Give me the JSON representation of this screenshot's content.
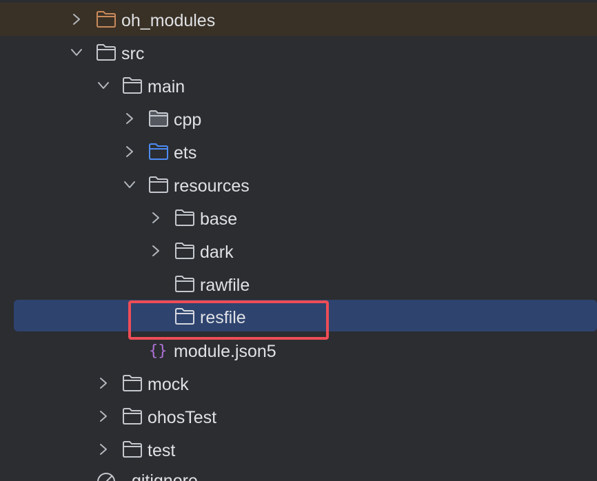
{
  "tree": {
    "items": [
      {
        "label": "oh_modules",
        "icon": "folder-icon",
        "chevron": "right",
        "color": "#c98a5b"
      },
      {
        "label": "src",
        "icon": "folder-icon",
        "chevron": "down"
      },
      {
        "label": "main",
        "icon": "folder-icon",
        "chevron": "down"
      },
      {
        "label": "cpp",
        "icon": "folder-icon",
        "chevron": "right"
      },
      {
        "label": "ets",
        "icon": "folder-icon",
        "chevron": "right",
        "color": "#4d8cf5"
      },
      {
        "label": "resources",
        "icon": "folder-icon",
        "chevron": "down"
      },
      {
        "label": "base",
        "icon": "folder-icon",
        "chevron": "right"
      },
      {
        "label": "dark",
        "icon": "folder-icon",
        "chevron": "right"
      },
      {
        "label": "rawfile",
        "icon": "folder-icon",
        "chevron": "none"
      },
      {
        "label": "resfile",
        "icon": "folder-icon",
        "chevron": "none",
        "selected": true
      },
      {
        "label": "module.json5",
        "icon": "json-braces-icon",
        "chevron": "none",
        "color": "#b072d8"
      },
      {
        "label": "mock",
        "icon": "folder-icon",
        "chevron": "right"
      },
      {
        "label": "ohosTest",
        "icon": "folder-icon",
        "chevron": "right"
      },
      {
        "label": "test",
        "icon": "folder-icon",
        "chevron": "right"
      },
      {
        "label": ".gitignore",
        "icon": "ignored-file-icon",
        "chevron": "none"
      }
    ]
  },
  "colors": {
    "background": "#2b2d30",
    "selection": "#2e436e",
    "annotation": "#ee4d57",
    "text": "#dfe1e5"
  }
}
